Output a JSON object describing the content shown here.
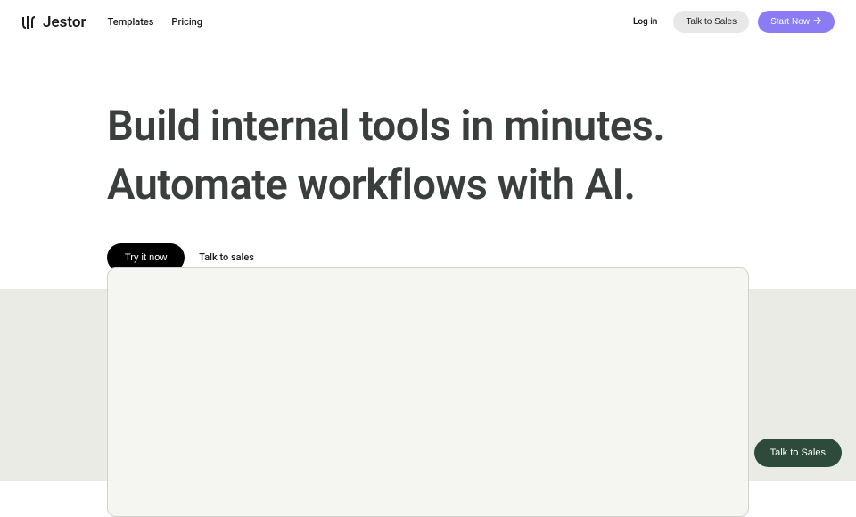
{
  "header": {
    "logo_text": "Jestor",
    "nav": {
      "templates": "Templates",
      "pricing": "Pricing"
    },
    "login": "Log in",
    "talk_to_sales": "Talk to Sales",
    "start_now": "Start Now"
  },
  "hero": {
    "title_line1": "Build internal tools in minutes.",
    "title_line2": "Automate workflows with AI.",
    "try_it_now": "Try it now",
    "talk_to_sales": "Talk to sales"
  },
  "floating": {
    "talk_to_sales": "Talk to Sales"
  }
}
